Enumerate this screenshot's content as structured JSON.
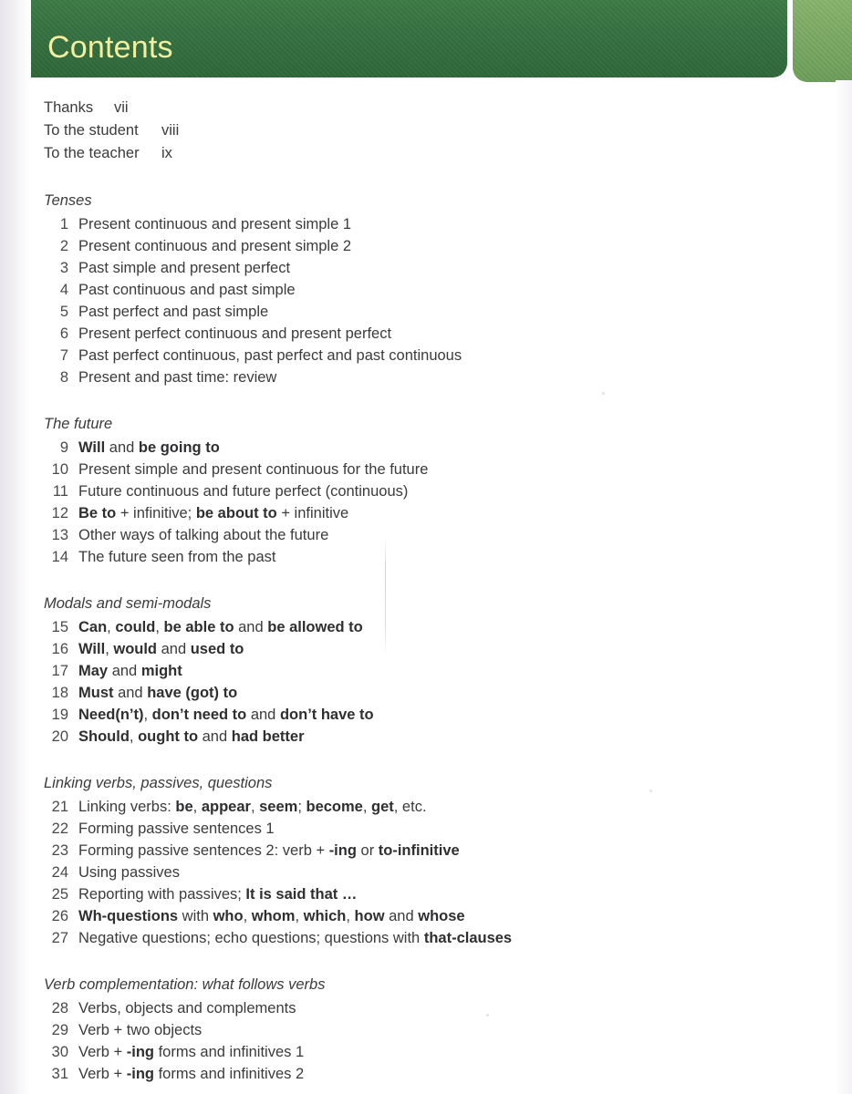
{
  "header": {
    "title": "Contents",
    "band_color": "#2e6637",
    "tab_color": "#79a861",
    "title_color": "#f2efa0"
  },
  "front_matter": [
    {
      "label": "Thanks",
      "page": "vii"
    },
    {
      "label": "To the student",
      "page": "viii"
    },
    {
      "label": "To the teacher",
      "page": "ix"
    }
  ],
  "sections": [
    {
      "title": "Tenses",
      "units": [
        {
          "num": "1",
          "text": "Present continuous and present simple 1"
        },
        {
          "num": "2",
          "text": "Present continuous and present simple 2"
        },
        {
          "num": "3",
          "text": "Past simple and present perfect"
        },
        {
          "num": "4",
          "text": "Past continuous and past simple"
        },
        {
          "num": "5",
          "text": "Past perfect and past simple"
        },
        {
          "num": "6",
          "text": "Present perfect continuous and present perfect"
        },
        {
          "num": "7",
          "text": "Past perfect continuous, past perfect and past continuous"
        },
        {
          "num": "8",
          "text": "Present and past time: review"
        }
      ]
    },
    {
      "title": "The future",
      "units": [
        {
          "num": "9",
          "html": "<b>Will</b> and <b>be going to</b>"
        },
        {
          "num": "10",
          "text": "Present simple and present continuous for the future"
        },
        {
          "num": "11",
          "text": "Future continuous and future perfect (continuous)"
        },
        {
          "num": "12",
          "html": "<b>Be to</b> + infinitive; <b>be about to</b> + infinitive"
        },
        {
          "num": "13",
          "text": "Other ways of talking about the future"
        },
        {
          "num": "14",
          "text": "The future seen from the past"
        }
      ]
    },
    {
      "title": "Modals and semi-modals",
      "units": [
        {
          "num": "15",
          "html": "<b>Can</b>, <b>could</b>, <b>be able to</b> and <b>be allowed to</b>"
        },
        {
          "num": "16",
          "html": "<b>Will</b>, <b>would</b> and <b>used to</b>"
        },
        {
          "num": "17",
          "html": "<b>May</b> and <b>might</b>"
        },
        {
          "num": "18",
          "html": "<b>Must</b> and <b>have (got) to</b>"
        },
        {
          "num": "19",
          "html": "<b>Need(n’t)</b>, <b>don’t need to</b> and <b>don’t have to</b>"
        },
        {
          "num": "20",
          "html": "<b>Should</b>, <b>ought to</b> and <b>had better</b>"
        }
      ]
    },
    {
      "title": "Linking verbs, passives, questions",
      "units": [
        {
          "num": "21",
          "html": "Linking verbs: <b>be</b>, <b>appear</b>, <b>seem</b>; <b>become</b>, <b>get</b>, etc."
        },
        {
          "num": "22",
          "text": "Forming passive sentences 1"
        },
        {
          "num": "23",
          "html": "Forming passive sentences 2: verb + <b>-ing</b> or <b>to-infinitive</b>"
        },
        {
          "num": "24",
          "text": "Using passives"
        },
        {
          "num": "25",
          "html": "Reporting with passives; <b>It is said that …</b>"
        },
        {
          "num": "26",
          "html": "<b>Wh-questions</b> with <b>who</b>, <b>whom</b>, <b>which</b>, <b>how</b> and <b>whose</b>"
        },
        {
          "num": "27",
          "html": "Negative questions; echo questions; questions with <b>that-clauses</b>"
        }
      ]
    },
    {
      "title": "Verb complementation: what follows verbs",
      "units": [
        {
          "num": "28",
          "text": "Verbs, objects and complements"
        },
        {
          "num": "29",
          "text": "Verb + two objects"
        },
        {
          "num": "30",
          "html": "Verb + <b>-ing</b> forms and infinitives 1"
        },
        {
          "num": "31",
          "html": "Verb + <b>-ing</b> forms and infinitives 2"
        }
      ]
    }
  ]
}
